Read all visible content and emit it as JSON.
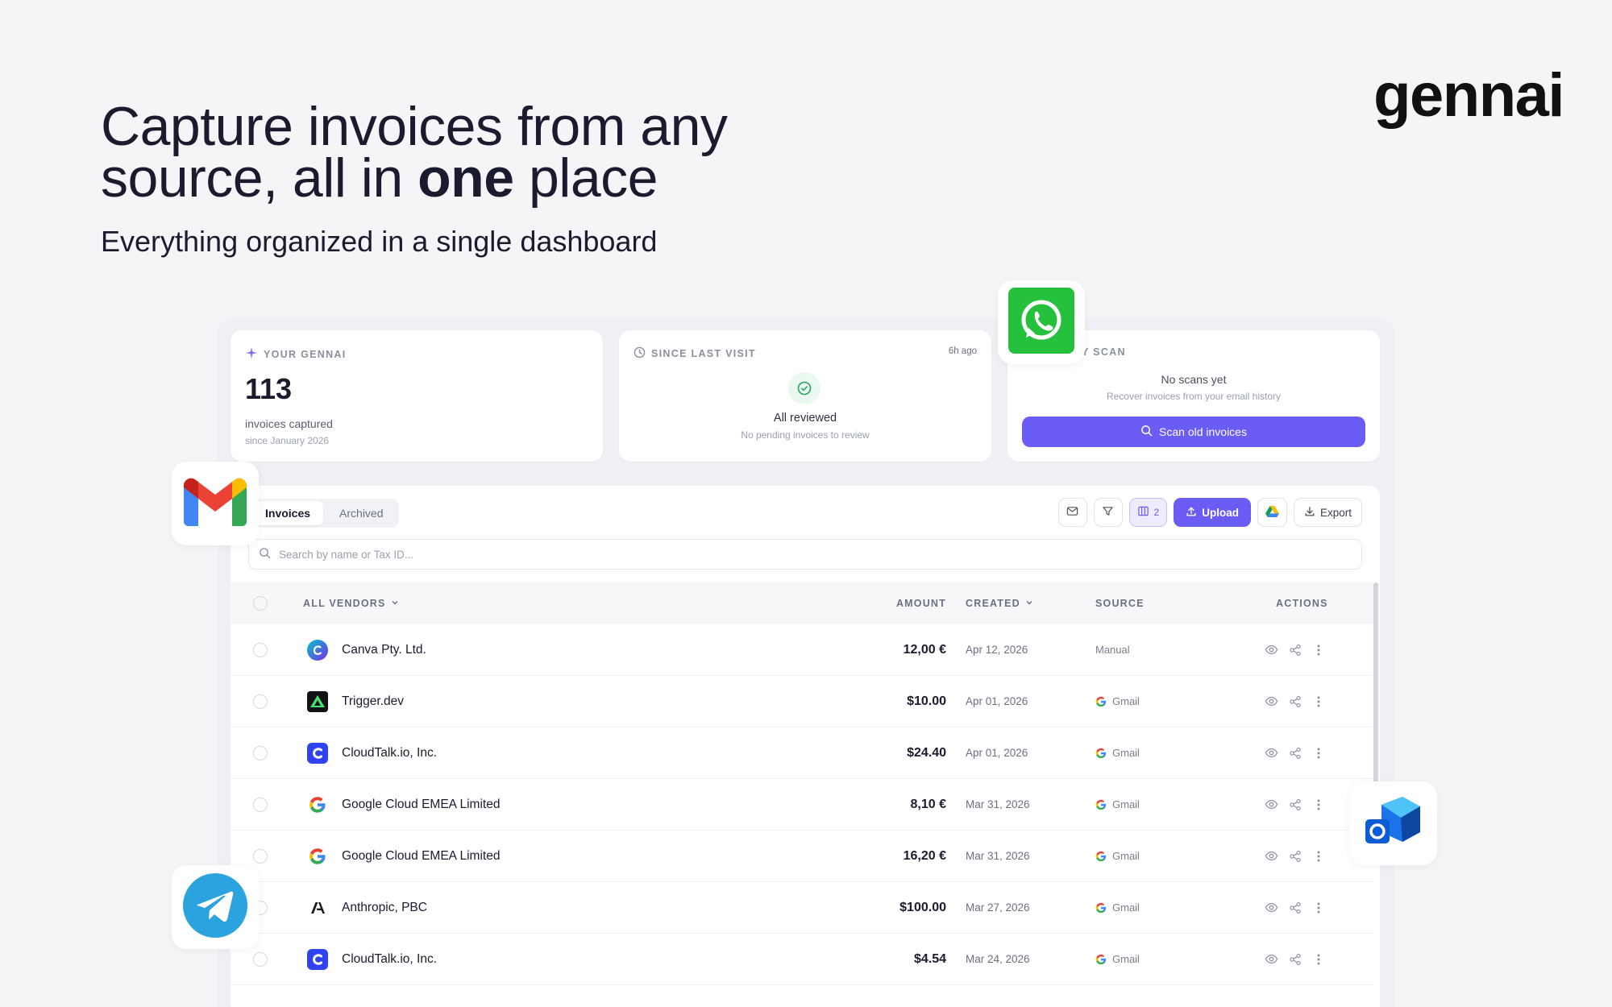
{
  "hero": {
    "title_line1": "Capture invoices from any",
    "title_line2_pre": "source, all in ",
    "title_line2_bold": "one",
    "title_line2_post": " place",
    "subtitle": "Everything organized in a single dashboard"
  },
  "brand": "gennai",
  "cards": {
    "your_gennai": {
      "title": "YOUR GENNAI",
      "count": "113",
      "label": "invoices captured",
      "since": "since January 2026"
    },
    "since_last_visit": {
      "title": "SINCE LAST VISIT",
      "time": "6h ago",
      "status": "All reviewed",
      "detail": "No pending invoices to review"
    },
    "history_scan": {
      "title": "Y SCAN",
      "status": "No scans yet",
      "detail": "Recover invoices from your email history",
      "button": "Scan old invoices"
    }
  },
  "tabs": [
    {
      "label": "Invoices",
      "active": true
    },
    {
      "label": "Archived",
      "active": false
    }
  ],
  "toolbar": {
    "columns_count": "2",
    "upload": "Upload",
    "export": "Export"
  },
  "search": {
    "placeholder": "Search by name or Tax ID..."
  },
  "table": {
    "headers": {
      "vendor": "ALL VENDORS",
      "amount": "AMOUNT",
      "created": "CREATED",
      "source": "SOURCE",
      "actions": "ACTIONS"
    },
    "rows": [
      {
        "vendor": "Canva Pty. Ltd.",
        "amount": "12,00 €",
        "created": "Apr 12, 2026",
        "source": "Manual",
        "logo": "canva-logo"
      },
      {
        "vendor": "Trigger.dev",
        "amount": "$10.00",
        "created": "Apr 01, 2026",
        "source": "Gmail",
        "logo": "trigger-logo"
      },
      {
        "vendor": "CloudTalk.io, Inc.",
        "amount": "$24.40",
        "created": "Apr 01, 2026",
        "source": "Gmail",
        "logo": "cloudtalk-logo"
      },
      {
        "vendor": "Google Cloud EMEA Limited",
        "amount": "8,10 €",
        "created": "Mar 31, 2026",
        "source": "Gmail",
        "logo": "google-logo"
      },
      {
        "vendor": "Google Cloud EMEA Limited",
        "amount": "16,20 €",
        "created": "Mar 31, 2026",
        "source": "Gmail",
        "logo": "google-logo"
      },
      {
        "vendor": "Anthropic, PBC",
        "amount": "$100.00",
        "created": "Mar 27, 2026",
        "source": "Gmail",
        "logo": "anthropic-logo"
      },
      {
        "vendor": "CloudTalk.io, Inc.",
        "amount": "$4.54",
        "created": "Mar 24, 2026",
        "source": "Gmail",
        "logo": "cloudtalk-logo"
      }
    ]
  },
  "colors": {
    "accent": "#6b5cf6",
    "background": "#f5f5f8",
    "whatsapp": "#25c13d",
    "telegram": "#2aa3de",
    "success": "#22a55a"
  },
  "floating_icons": [
    "whatsapp-icon",
    "gmail-icon",
    "outlook-icon",
    "telegram-icon"
  ]
}
